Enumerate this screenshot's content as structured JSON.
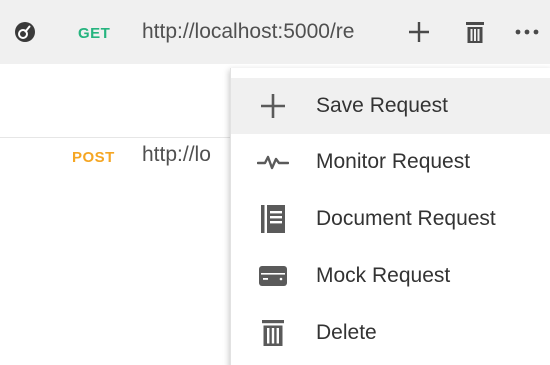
{
  "requests": [
    {
      "method": "GET",
      "url": "http://localhost:5000/re",
      "method_color": "#26b47f"
    },
    {
      "method": "POST",
      "url": "http://lo",
      "method_color": "#f5a623"
    }
  ],
  "row_actions": {
    "add": "plus-icon",
    "delete": "trash-icon",
    "more": "more-icon"
  },
  "menu": {
    "items": [
      {
        "label": "Save Request",
        "icon": "plus-icon"
      },
      {
        "label": "Monitor Request",
        "icon": "pulse-icon"
      },
      {
        "label": "Document Request",
        "icon": "document-icon"
      },
      {
        "label": "Mock Request",
        "icon": "server-icon"
      },
      {
        "label": "Delete",
        "icon": "trash-icon"
      }
    ]
  },
  "colors": {
    "get": "#26b47f",
    "post": "#f5a623",
    "icon": "#5a5a5a",
    "highlight": "#f0f0f0"
  }
}
